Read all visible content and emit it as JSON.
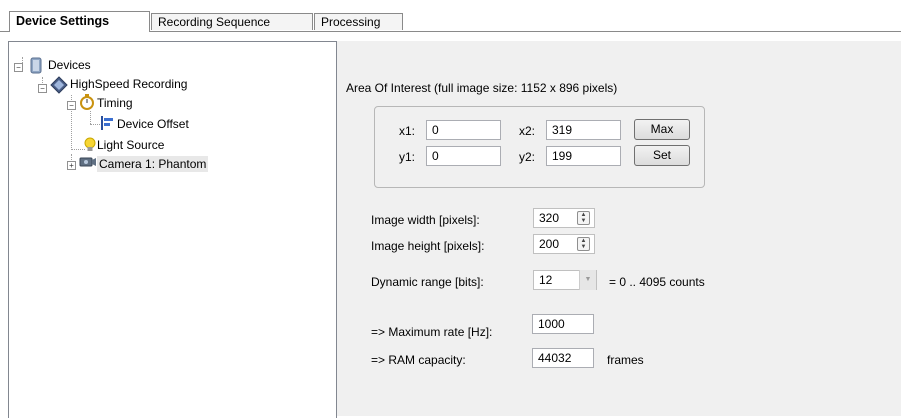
{
  "tabs": [
    {
      "label": "Device Settings",
      "active": true
    },
    {
      "label": "Recording Sequence",
      "active": false
    },
    {
      "label": "Processing",
      "active": false
    }
  ],
  "tree": {
    "root": "Devices",
    "recording": "HighSpeed Recording",
    "timing": "Timing",
    "device_offset": "Device Offset",
    "light_source": "Light Source",
    "camera": "Camera 1: Phantom",
    "collapse_glyph": "−",
    "expand_glyph": "+"
  },
  "aoi": {
    "title": "Area Of Interest  (full image size: 1152 x 896 pixels)",
    "x1_label": "x1:",
    "x1_value": "0",
    "y1_label": "y1:",
    "y1_value": "0",
    "x2_label": "x2:",
    "x2_value": "319",
    "y2_label": "y2:",
    "y2_value": "199",
    "max_button": "Max",
    "set_button": "Set"
  },
  "settings": {
    "width_label": "Image width [pixels]:",
    "width_value": "320",
    "height_label": "Image height [pixels]:",
    "height_value": "200",
    "range_label": "Dynamic range [bits]:",
    "range_value": "12",
    "range_note": "= 0 .. 4095 counts",
    "max_rate_label": "=> Maximum rate [Hz]:",
    "max_rate_value": "1000",
    "ram_label": "=> RAM capacity:",
    "ram_value": "44032",
    "ram_unit": "frames"
  },
  "icons": {
    "spin": "spinner-icon",
    "dropdown": "chevron-down-icon"
  },
  "colors": {
    "panel_bg": "#f0f0f0",
    "tree_bg": "#ffffff",
    "border": "#828790"
  }
}
